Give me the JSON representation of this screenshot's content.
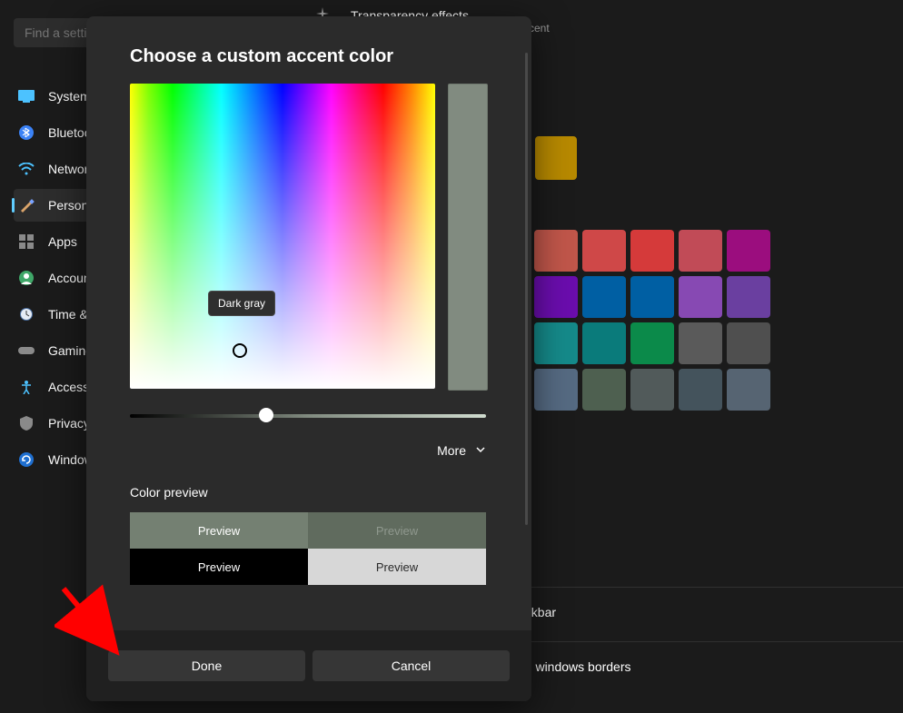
{
  "search": {
    "placeholder": "Find a setting"
  },
  "sidebar": {
    "items": [
      {
        "label": "System"
      },
      {
        "label": "Bluetooth"
      },
      {
        "label": "Network"
      },
      {
        "label": "Personalization"
      },
      {
        "label": "Apps"
      },
      {
        "label": "Accounts"
      },
      {
        "label": "Time & language"
      },
      {
        "label": "Gaming"
      },
      {
        "label": "Accessibility"
      },
      {
        "label": "Privacy & security"
      },
      {
        "label": "Windows Update"
      }
    ]
  },
  "content": {
    "transparency": "Transparency effects",
    "accent_caption_suffix": "cent",
    "setting_taskbar_suffix": "askbar",
    "setting_borders_suffix": "nd windows borders",
    "swatches_row1": [
      "#0067c0",
      "#b78900"
    ],
    "grid_colors": [
      "#d84315",
      "#c0564a",
      "#cf4848",
      "#d53a3a",
      "#c14b57",
      "#9b0d7e",
      "#8a0a8a",
      "#6a0dad",
      "#005fa3",
      "#005fa3",
      "#8749b3",
      "#6a3fa0",
      "#0c8a8a",
      "#158a8a",
      "#0a7b7b",
      "#0b8a4a",
      "#5a5a5a",
      "#4f4f4f",
      "#5a6a82",
      "#556a82",
      "#4e6050",
      "#515a5a",
      "#44535c",
      "#566472",
      "#617160"
    ]
  },
  "dialog": {
    "title": "Choose a custom accent color",
    "tooltip": "Dark gray",
    "more": "More",
    "color_preview_label": "Color preview",
    "preview_cells": [
      "Preview",
      "Preview",
      "Preview",
      "Preview"
    ],
    "done": "Done",
    "cancel": "Cancel",
    "selected_color": "#818b80"
  }
}
